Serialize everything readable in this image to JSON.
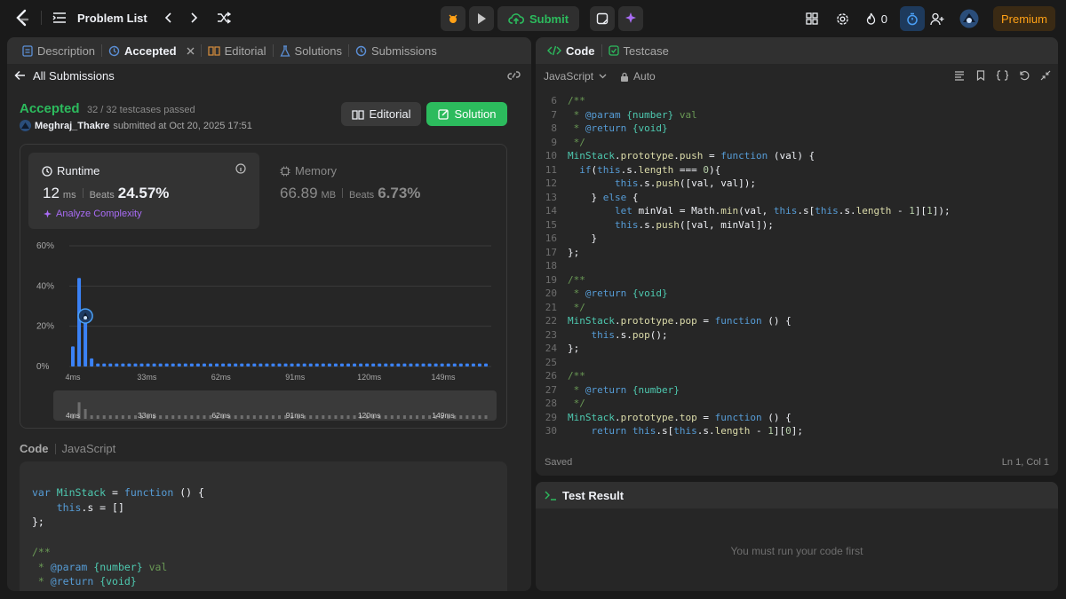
{
  "topbar": {
    "problem_list": "Problem List",
    "submit": "Submit",
    "fire_count": "0",
    "premium": "Premium"
  },
  "left": {
    "tabs": [
      "Description",
      "Accepted",
      "Editorial",
      "Solutions",
      "Submissions"
    ],
    "back_label": "All Submissions",
    "status": "Accepted",
    "testcases": "32 / 32 testcases passed",
    "user": "Meghraj_Thakre",
    "submitted_text": "submitted at Oct 20, 2025 17:51",
    "editorial_btn": "Editorial",
    "solution_btn": "Solution",
    "runtime": {
      "label": "Runtime",
      "value": "12",
      "unit": "ms",
      "beats_label": "Beats",
      "beats": "24.57%",
      "analyze": "Analyze Complexity"
    },
    "memory": {
      "label": "Memory",
      "value": "66.89",
      "unit": "MB",
      "beats_label": "Beats",
      "beats": "6.73%"
    },
    "code_label": "Code",
    "code_lang": "JavaScript"
  },
  "chart_data": {
    "type": "bar",
    "y_ticks": [
      "60%",
      "40%",
      "20%",
      "0%"
    ],
    "ylim": [
      0,
      60
    ],
    "x_ticks": [
      "4ms",
      "33ms",
      "62ms",
      "91ms",
      "120ms",
      "149ms"
    ],
    "values": [
      10,
      44,
      26,
      4,
      1.5,
      1.5,
      1.5,
      1.5,
      1.5,
      1.5,
      1.5,
      1.5,
      1.5,
      1.5,
      1.5,
      1.5,
      1.5,
      1.5,
      1.5,
      1.5,
      1.5,
      1.5,
      1.5,
      1.5,
      1.5,
      1.5,
      1.5,
      1.5,
      1.5,
      1.5,
      1.5,
      1.5,
      1.5,
      1.5,
      1.5,
      1.5,
      1.5,
      1.5,
      1.5,
      1.5,
      1.5,
      1.5,
      1.5,
      1.5,
      1.5,
      1.5,
      1.5,
      1.5,
      1.5,
      1.5,
      1.5,
      1.5,
      1.5,
      1.5,
      1.5,
      1.5,
      1.5,
      1.5,
      1.5,
      1.5,
      1.5,
      1.5,
      1.5,
      1.5,
      1.5,
      1.5,
      1.5
    ],
    "highlight_index": 2,
    "overview_ticks": [
      "4ms",
      "33ms",
      "62ms",
      "91ms",
      "120ms",
      "149ms"
    ]
  },
  "left_code": [
    "var MinStack = function () {",
    "    this.s = []",
    "};",
    "",
    "/**",
    " * @param {number} val",
    " * @return {void}"
  ],
  "editor": {
    "tab_code": "Code",
    "tab_testcase": "Testcase",
    "language": "JavaScript",
    "mode": "Auto",
    "lines": [
      {
        "n": "6",
        "t": "/**"
      },
      {
        "n": "7",
        "t": " * @param {number} val"
      },
      {
        "n": "8",
        "t": " * @return {void}"
      },
      {
        "n": "9",
        "t": " */"
      },
      {
        "n": "10",
        "t": "MinStack.prototype.push = function (val) {"
      },
      {
        "n": "11",
        "t": "  if(this.s.length === 0){"
      },
      {
        "n": "12",
        "t": "        this.s.push([val, val]);"
      },
      {
        "n": "13",
        "t": "    } else {"
      },
      {
        "n": "14",
        "t": "        let minVal = Math.min(val, this.s[this.s.length - 1][1]);"
      },
      {
        "n": "15",
        "t": "        this.s.push([val, minVal]);"
      },
      {
        "n": "16",
        "t": "    }"
      },
      {
        "n": "17",
        "t": "};"
      },
      {
        "n": "18",
        "t": ""
      },
      {
        "n": "19",
        "t": "/**"
      },
      {
        "n": "20",
        "t": " * @return {void}"
      },
      {
        "n": "21",
        "t": " */"
      },
      {
        "n": "22",
        "t": "MinStack.prototype.pop = function () {"
      },
      {
        "n": "23",
        "t": "    this.s.pop();"
      },
      {
        "n": "24",
        "t": "};"
      },
      {
        "n": "25",
        "t": ""
      },
      {
        "n": "26",
        "t": "/**"
      },
      {
        "n": "27",
        "t": " * @return {number}"
      },
      {
        "n": "28",
        "t": " */"
      },
      {
        "n": "29",
        "t": "MinStack.prototype.top = function () {"
      },
      {
        "n": "30",
        "t": "    return this.s[this.s.length - 1][0];"
      }
    ],
    "saved": "Saved",
    "cursor": "Ln 1, Col 1"
  },
  "result": {
    "title": "Test Result",
    "message": "You must run your code first"
  }
}
